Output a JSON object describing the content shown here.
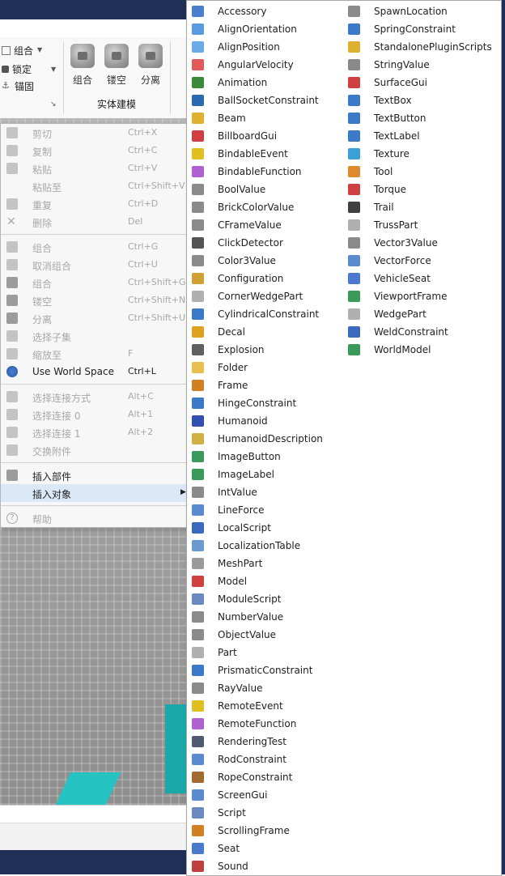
{
  "ribbon": {
    "group_label": "组合",
    "lock_label": "锁定",
    "anchor_label": "锚固",
    "big_buttons": [
      "组合",
      "镂空",
      "分离"
    ],
    "section_title": "实体建模"
  },
  "context_menu": {
    "items": [
      {
        "label": "剪切",
        "shortcut": "Ctrl+X"
      },
      {
        "label": "复制",
        "shortcut": "Ctrl+C"
      },
      {
        "label": "粘贴",
        "shortcut": "Ctrl+V"
      },
      {
        "label": "粘贴至",
        "shortcut": "Ctrl+Shift+V"
      },
      {
        "label": "重复",
        "shortcut": "Ctrl+D"
      },
      {
        "label": "删除",
        "shortcut": "Del"
      },
      {
        "label": "组合",
        "shortcut": "Ctrl+G"
      },
      {
        "label": "取消组合",
        "shortcut": "Ctrl+U"
      },
      {
        "label": "组合",
        "shortcut": "Ctrl+Shift+G"
      },
      {
        "label": "镂空",
        "shortcut": "Ctrl+Shift+N"
      },
      {
        "label": "分离",
        "shortcut": "Ctrl+Shift+U"
      },
      {
        "label": "选择子集",
        "shortcut": ""
      },
      {
        "label": "缩放至",
        "shortcut": "F"
      },
      {
        "label": "Use World Space",
        "shortcut": "Ctrl+L"
      },
      {
        "label": "选择连接方式",
        "shortcut": "Alt+C"
      },
      {
        "label": "选择连接 0",
        "shortcut": "Alt+1"
      },
      {
        "label": "选择连接 1",
        "shortcut": "Alt+2"
      },
      {
        "label": "交换附件",
        "shortcut": ""
      },
      {
        "label": "插入部件",
        "shortcut": ""
      },
      {
        "label": "插入对象",
        "shortcut": ""
      },
      {
        "label": "帮助",
        "shortcut": ""
      }
    ]
  },
  "insert_object_menu": {
    "col1": [
      {
        "label": "Accessory",
        "icon": "accessory-icon",
        "color": "#4a7fd0"
      },
      {
        "label": "AlignOrientation",
        "icon": "align-orientation-icon",
        "color": "#5a9ae0"
      },
      {
        "label": "AlignPosition",
        "icon": "align-position-icon",
        "color": "#6aaae8"
      },
      {
        "label": "AngularVelocity",
        "icon": "angular-velocity-icon",
        "color": "#e05a5a"
      },
      {
        "label": "Animation",
        "icon": "animation-icon",
        "color": "#3a8a3a"
      },
      {
        "label": "BallSocketConstraint",
        "icon": "ball-socket-icon",
        "color": "#2a6ab0"
      },
      {
        "label": "Beam",
        "icon": "beam-icon",
        "color": "#e0b030"
      },
      {
        "label": "BillboardGui",
        "icon": "billboard-gui-icon",
        "color": "#d04040"
      },
      {
        "label": "BindableEvent",
        "icon": "bindable-event-icon",
        "color": "#e0c020"
      },
      {
        "label": "BindableFunction",
        "icon": "bindable-function-icon",
        "color": "#b060d0"
      },
      {
        "label": "BoolValue",
        "icon": "value-icon",
        "color": "#8a8a8a"
      },
      {
        "label": "BrickColorValue",
        "icon": "value-icon",
        "color": "#8a8a8a"
      },
      {
        "label": "CFrameValue",
        "icon": "value-icon",
        "color": "#8a8a8a"
      },
      {
        "label": "ClickDetector",
        "icon": "click-detector-icon",
        "color": "#555555"
      },
      {
        "label": "Color3Value",
        "icon": "value-icon",
        "color": "#8a8a8a"
      },
      {
        "label": "Configuration",
        "icon": "configuration-icon",
        "color": "#d0a030"
      },
      {
        "label": "CornerWedgePart",
        "icon": "part-icon",
        "color": "#b0b0b0"
      },
      {
        "label": "CylindricalConstraint",
        "icon": "cylindrical-icon",
        "color": "#3a7ac8"
      },
      {
        "label": "Decal",
        "icon": "decal-icon",
        "color": "#e0a020"
      },
      {
        "label": "Explosion",
        "icon": "explosion-icon",
        "color": "#606060"
      },
      {
        "label": "Folder",
        "icon": "folder-icon",
        "color": "#e8c050"
      },
      {
        "label": "Frame",
        "icon": "frame-icon",
        "color": "#d08020"
      },
      {
        "label": "HingeConstraint",
        "icon": "hinge-icon",
        "color": "#3a7ac8"
      },
      {
        "label": "Humanoid",
        "icon": "humanoid-icon",
        "color": "#3050b0"
      },
      {
        "label": "HumanoidDescription",
        "icon": "humanoid-description-icon",
        "color": "#d0b040"
      },
      {
        "label": "ImageButton",
        "icon": "image-button-icon",
        "color": "#3a9a5a"
      },
      {
        "label": "ImageLabel",
        "icon": "image-label-icon",
        "color": "#3a9a5a"
      },
      {
        "label": "IntValue",
        "icon": "value-icon",
        "color": "#8a8a8a"
      },
      {
        "label": "LineForce",
        "icon": "line-force-icon",
        "color": "#5a8ad0"
      },
      {
        "label": "LocalScript",
        "icon": "local-script-icon",
        "color": "#3a6ac0"
      },
      {
        "label": "LocalizationTable",
        "icon": "localization-table-icon",
        "color": "#6a9ad0"
      },
      {
        "label": "MeshPart",
        "icon": "mesh-part-icon",
        "color": "#9a9a9a"
      },
      {
        "label": "Model",
        "icon": "model-icon",
        "color": "#d04040"
      },
      {
        "label": "ModuleScript",
        "icon": "module-script-icon",
        "color": "#6a8ac0"
      },
      {
        "label": "NumberValue",
        "icon": "value-icon",
        "color": "#8a8a8a"
      },
      {
        "label": "ObjectValue",
        "icon": "value-icon",
        "color": "#8a8a8a"
      },
      {
        "label": "Part",
        "icon": "part-icon",
        "color": "#b0b0b0"
      },
      {
        "label": "PrismaticConstraint",
        "icon": "prismatic-icon",
        "color": "#3a7ac8"
      },
      {
        "label": "RayValue",
        "icon": "value-icon",
        "color": "#8a8a8a"
      },
      {
        "label": "RemoteEvent",
        "icon": "remote-event-icon",
        "color": "#e0c020"
      },
      {
        "label": "RemoteFunction",
        "icon": "remote-function-icon",
        "color": "#b060d0"
      },
      {
        "label": "RenderingTest",
        "icon": "rendering-test-icon",
        "color": "#505a70"
      },
      {
        "label": "RodConstraint",
        "icon": "rod-icon",
        "color": "#5a8ad0"
      },
      {
        "label": "RopeConstraint",
        "icon": "rope-icon",
        "color": "#a06a30"
      },
      {
        "label": "ScreenGui",
        "icon": "screen-gui-icon",
        "color": "#5a8ad0"
      },
      {
        "label": "Script",
        "icon": "script-icon",
        "color": "#6a8ac0"
      },
      {
        "label": "ScrollingFrame",
        "icon": "scrolling-frame-icon",
        "color": "#d08020"
      },
      {
        "label": "Seat",
        "icon": "seat-icon",
        "color": "#4a7ad0"
      },
      {
        "label": "Sound",
        "icon": "sound-icon",
        "color": "#c04040"
      }
    ],
    "col2": [
      {
        "label": "SpawnLocation",
        "icon": "spawn-location-icon",
        "color": "#8a8a8a"
      },
      {
        "label": "SpringConstraint",
        "icon": "spring-icon",
        "color": "#3a7ac8"
      },
      {
        "label": "StandalonePluginScripts",
        "icon": "plugin-scripts-icon",
        "color": "#e0b030"
      },
      {
        "label": "StringValue",
        "icon": "value-icon",
        "color": "#8a8a8a"
      },
      {
        "label": "SurfaceGui",
        "icon": "surface-gui-icon",
        "color": "#d04040"
      },
      {
        "label": "TextBox",
        "icon": "text-box-icon",
        "color": "#3a7ac8"
      },
      {
        "label": "TextButton",
        "icon": "text-button-icon",
        "color": "#3a7ac8"
      },
      {
        "label": "TextLabel",
        "icon": "text-label-icon",
        "color": "#3a7ac8"
      },
      {
        "label": "Texture",
        "icon": "texture-icon",
        "color": "#3aa0d8"
      },
      {
        "label": "Tool",
        "icon": "tool-icon",
        "color": "#e08a30"
      },
      {
        "label": "Torque",
        "icon": "torque-icon",
        "color": "#d04040"
      },
      {
        "label": "Trail",
        "icon": "trail-icon",
        "color": "#404040"
      },
      {
        "label": "TrussPart",
        "icon": "part-icon",
        "color": "#b0b0b0"
      },
      {
        "label": "Vector3Value",
        "icon": "value-icon",
        "color": "#8a8a8a"
      },
      {
        "label": "VectorForce",
        "icon": "vector-force-icon",
        "color": "#5a8ad0"
      },
      {
        "label": "VehicleSeat",
        "icon": "vehicle-seat-icon",
        "color": "#4a7ad0"
      },
      {
        "label": "ViewportFrame",
        "icon": "viewport-frame-icon",
        "color": "#3a9a5a"
      },
      {
        "label": "WedgePart",
        "icon": "part-icon",
        "color": "#b0b0b0"
      },
      {
        "label": "WeldConstraint",
        "icon": "weld-icon",
        "color": "#3a6ac0"
      },
      {
        "label": "WorldModel",
        "icon": "world-model-icon",
        "color": "#3a9a5a"
      }
    ]
  },
  "colors": {
    "accent": "#1f2f55",
    "highlight": "#dbe8f8"
  }
}
